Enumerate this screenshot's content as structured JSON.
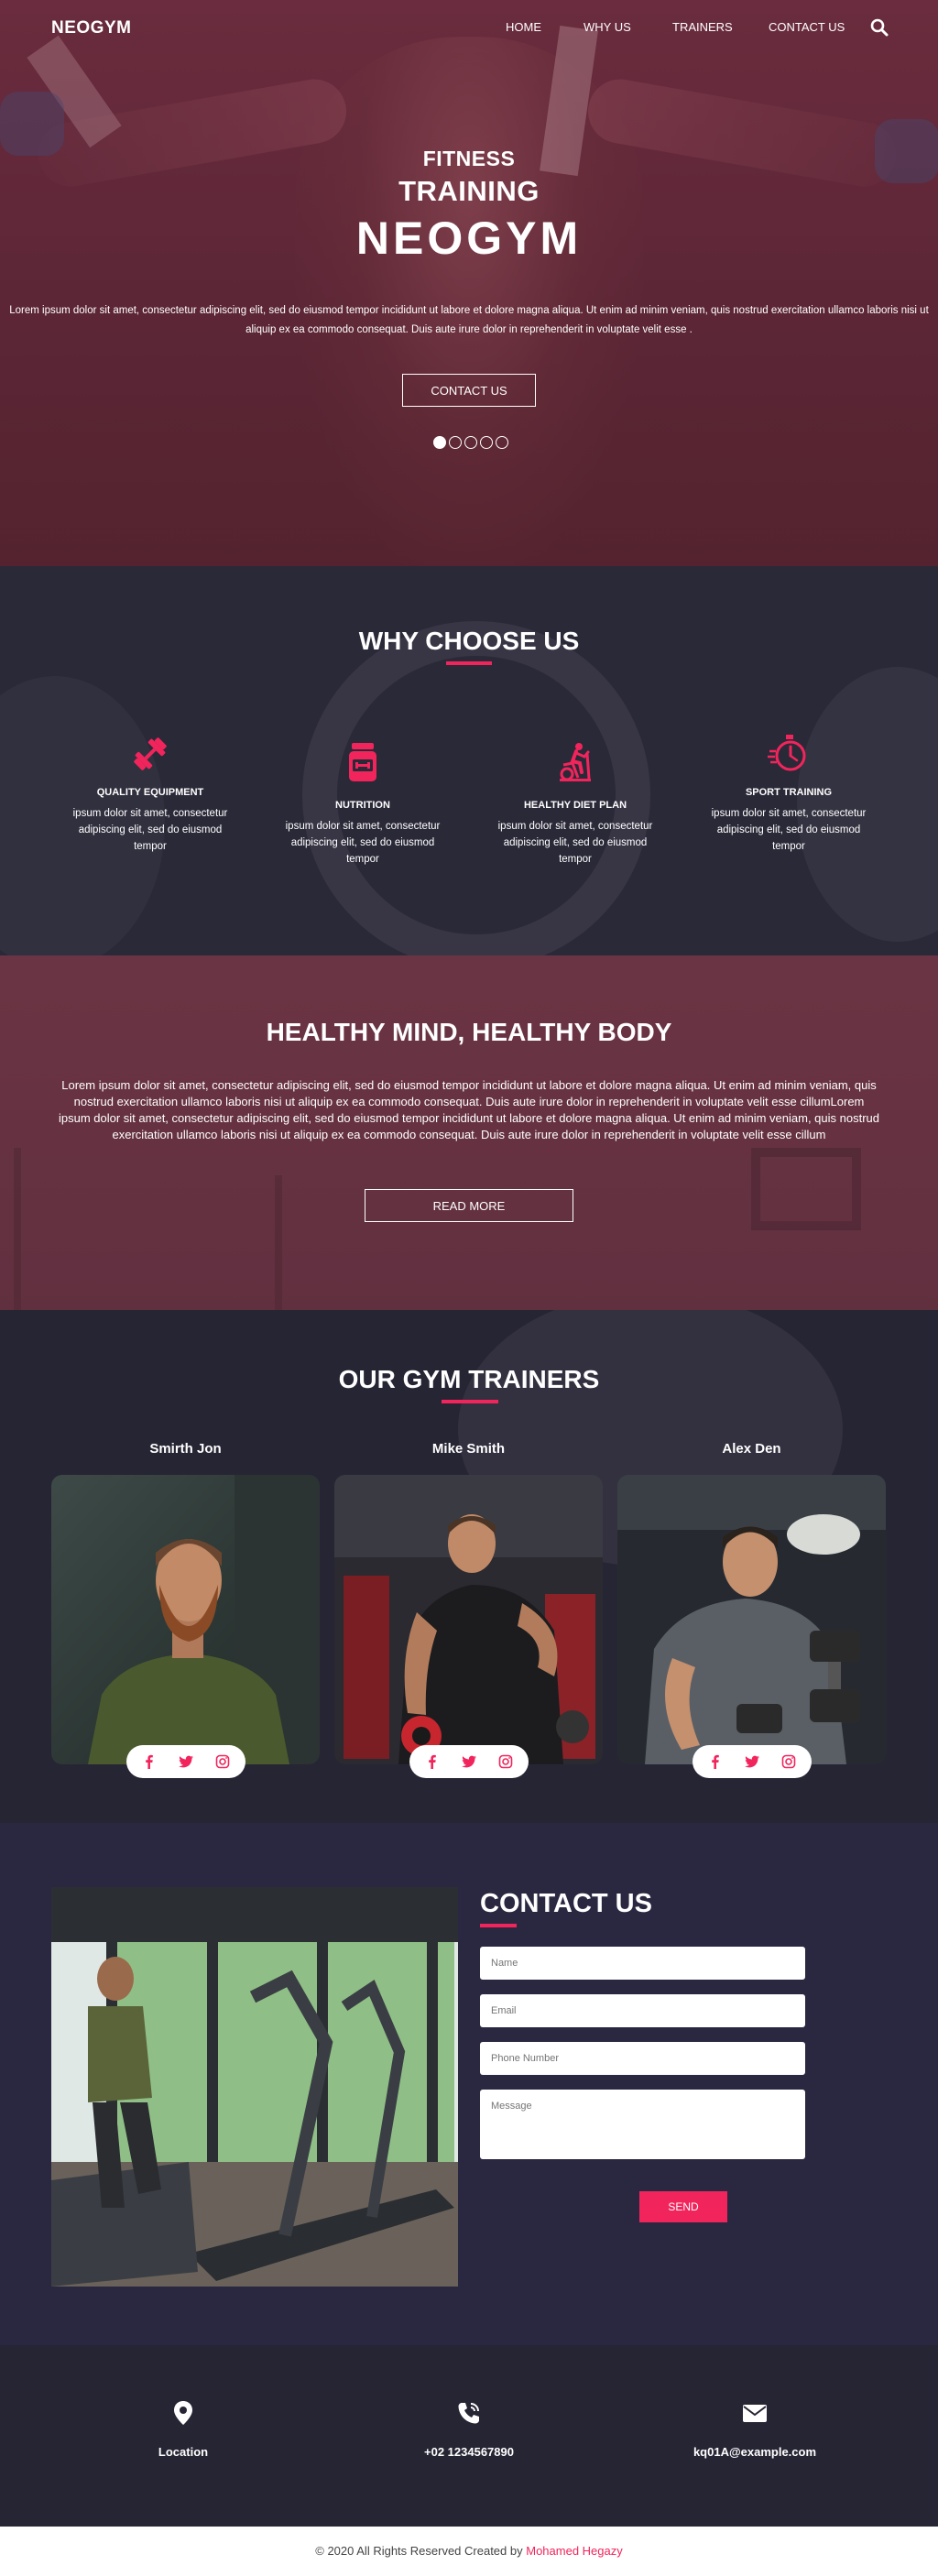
{
  "header": {
    "logo": "NEOGYM",
    "nav": [
      "HOME",
      "WHY US",
      "TRAINERS",
      "CONTACT US"
    ]
  },
  "hero": {
    "line1": "FITNESS",
    "line2": "TRAINING",
    "line3": "NEOGYM",
    "description": "Lorem ipsum dolor sit amet, consectetur adipiscing elit, sed do eiusmod tempor incididunt ut labore et dolore magna aliqua. Ut enim ad minim veniam, quis nostrud exercitation ullamco laboris nisi ut aliquip ex ea commodo consequat. Duis aute irure dolor in reprehenderit in voluptate velit esse .",
    "button": "CONTACT US",
    "slides_total": 5,
    "slide_active": 1
  },
  "why": {
    "title": "WHY CHOOSE US",
    "features": [
      {
        "icon": "dumbbell-icon",
        "title": "QUALITY EQUIPMENT",
        "desc": "ipsum dolor sit amet, consectetur adipiscing elit, sed do eiusmod tempor"
      },
      {
        "icon": "supplement-jar-icon",
        "title": "NUTRITION",
        "desc": "ipsum dolor sit amet, consectetur adipiscing elit, sed do eiusmod tempor"
      },
      {
        "icon": "exercise-bike-icon",
        "title": "HEALTHY DIET PLAN",
        "desc": "ipsum dolor sit amet, consectetur adipiscing elit, sed do eiusmod tempor"
      },
      {
        "icon": "stopwatch-icon",
        "title": "SPORT TRAINING",
        "desc": "ipsum dolor sit amet, consectetur adipiscing elit, sed do eiusmod tempor"
      }
    ]
  },
  "healthy": {
    "title": "HEALTHY MIND, HEALTHY BODY",
    "description": "Lorem ipsum dolor sit amet, consectetur adipiscing elit, sed do eiusmod tempor incididunt ut labore et dolore magna aliqua. Ut enim ad minim veniam, quis nostrud exercitation ullamco laboris nisi ut aliquip ex ea commodo consequat. Duis aute irure dolor in reprehenderit in voluptate velit esse cillumLorem ipsum dolor sit amet, consectetur adipiscing elit, sed do eiusmod tempor incididunt ut labore et dolore magna aliqua. Ut enim ad minim veniam, quis nostrud exercitation ullamco laboris nisi ut aliquip ex ea commodo consequat. Duis aute irure dolor in reprehenderit in voluptate velit esse cillum",
    "button": "READ MORE"
  },
  "trainers": {
    "title": "OUR GYM TRAINERS",
    "list": [
      {
        "name": "Smirth Jon"
      },
      {
        "name": "Mike Smith"
      },
      {
        "name": "Alex Den"
      }
    ],
    "social_icons": [
      "facebook-icon",
      "twitter-icon",
      "instagram-icon"
    ]
  },
  "contact": {
    "title": "CONTACT US",
    "name_placeholder": "Name",
    "email_placeholder": "Email",
    "phone_placeholder": "Phone Number",
    "message_placeholder": "Message",
    "send": "SEND"
  },
  "info": {
    "location": "Location",
    "phone": "+02 1234567890",
    "email": "kq01A@example.com"
  },
  "footer": {
    "text": "© 2020 All Rights Reserved Created by",
    "author": "Mohamed Hegazy"
  },
  "colors": {
    "accent": "#f1255c",
    "hero_bg": "#5c2636",
    "dark_bg": "#262534",
    "contact_bg": "#2a2741"
  }
}
